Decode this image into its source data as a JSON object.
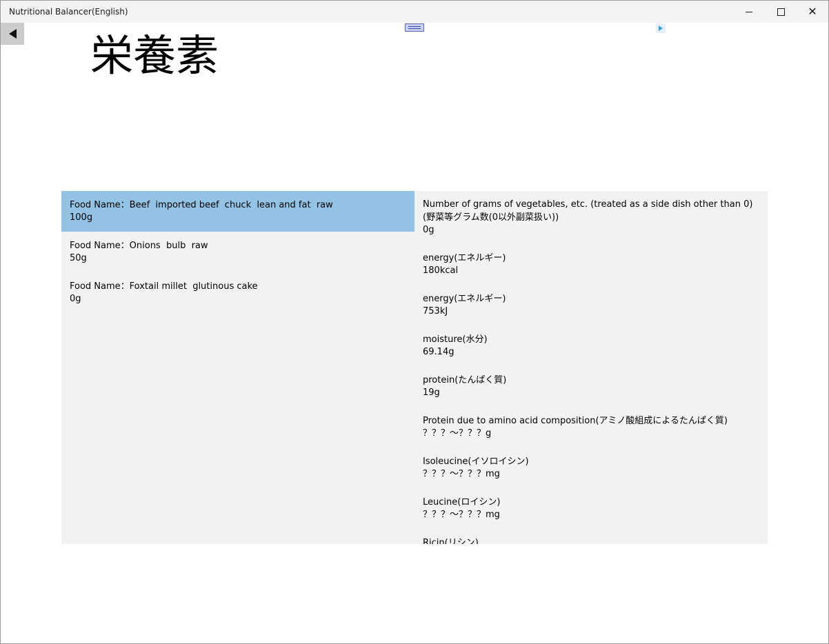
{
  "window": {
    "title": "Nutritional Balancer(English)"
  },
  "page": {
    "title": "栄養素"
  },
  "foods": [
    {
      "name_line": "Food Name：Beef  imported beef  chuck  lean and fat  raw",
      "amount": "100g",
      "selected": true
    },
    {
      "name_line": "Food Name：Onions  bulb  raw",
      "amount": "50g",
      "selected": false
    },
    {
      "name_line": "Food Name：Foxtail millet  glutinous cake",
      "amount": "0g",
      "selected": false
    }
  ],
  "nutrients": [
    {
      "label": "Number of grams of vegetables, etc. (treated as a side dish other than 0)",
      "label2": "(野菜等グラム数(0以外副菜扱い))",
      "value": "0g"
    },
    {
      "label": "energy(エネルギー)",
      "value": "180kcal"
    },
    {
      "label": "energy(エネルギー)",
      "value": "753kJ"
    },
    {
      "label": "moisture(水分)",
      "value": "69.14g"
    },
    {
      "label": "protein(たんぱく質)",
      "value": "19g"
    },
    {
      "label": "Protein due to amino acid composition(アミノ酸組成によるたんぱく質)",
      "value": "？？？～？？？g"
    },
    {
      "label": "Isoleucine(イソロイシン)",
      "value": "？？？～？？？mg"
    },
    {
      "label": "Leucine(ロイシン)",
      "value": "？？？～？？？mg"
    },
    {
      "label": "Ricin(リシン)",
      "value": ""
    }
  ]
}
